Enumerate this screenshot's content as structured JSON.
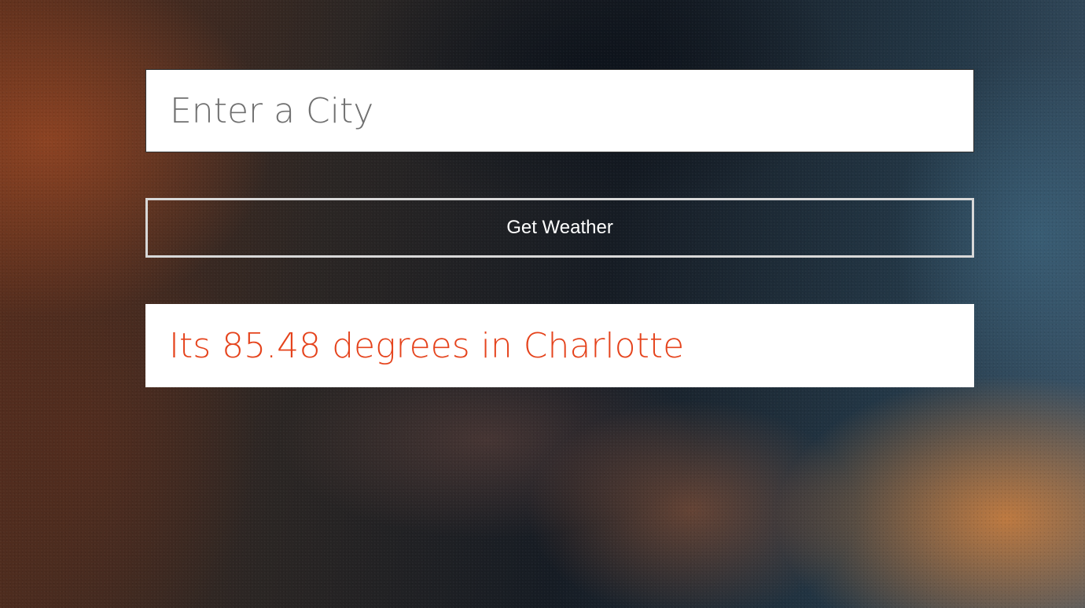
{
  "search": {
    "placeholder": "Enter a City",
    "value": ""
  },
  "button": {
    "label": "Get Weather"
  },
  "result": {
    "text": "Its 85.48 degrees in Charlotte",
    "color": "#e5431c"
  },
  "background": {
    "description_colors": [
      "#5a2e1c",
      "#161c24",
      "#233746",
      "#d6823c"
    ]
  }
}
